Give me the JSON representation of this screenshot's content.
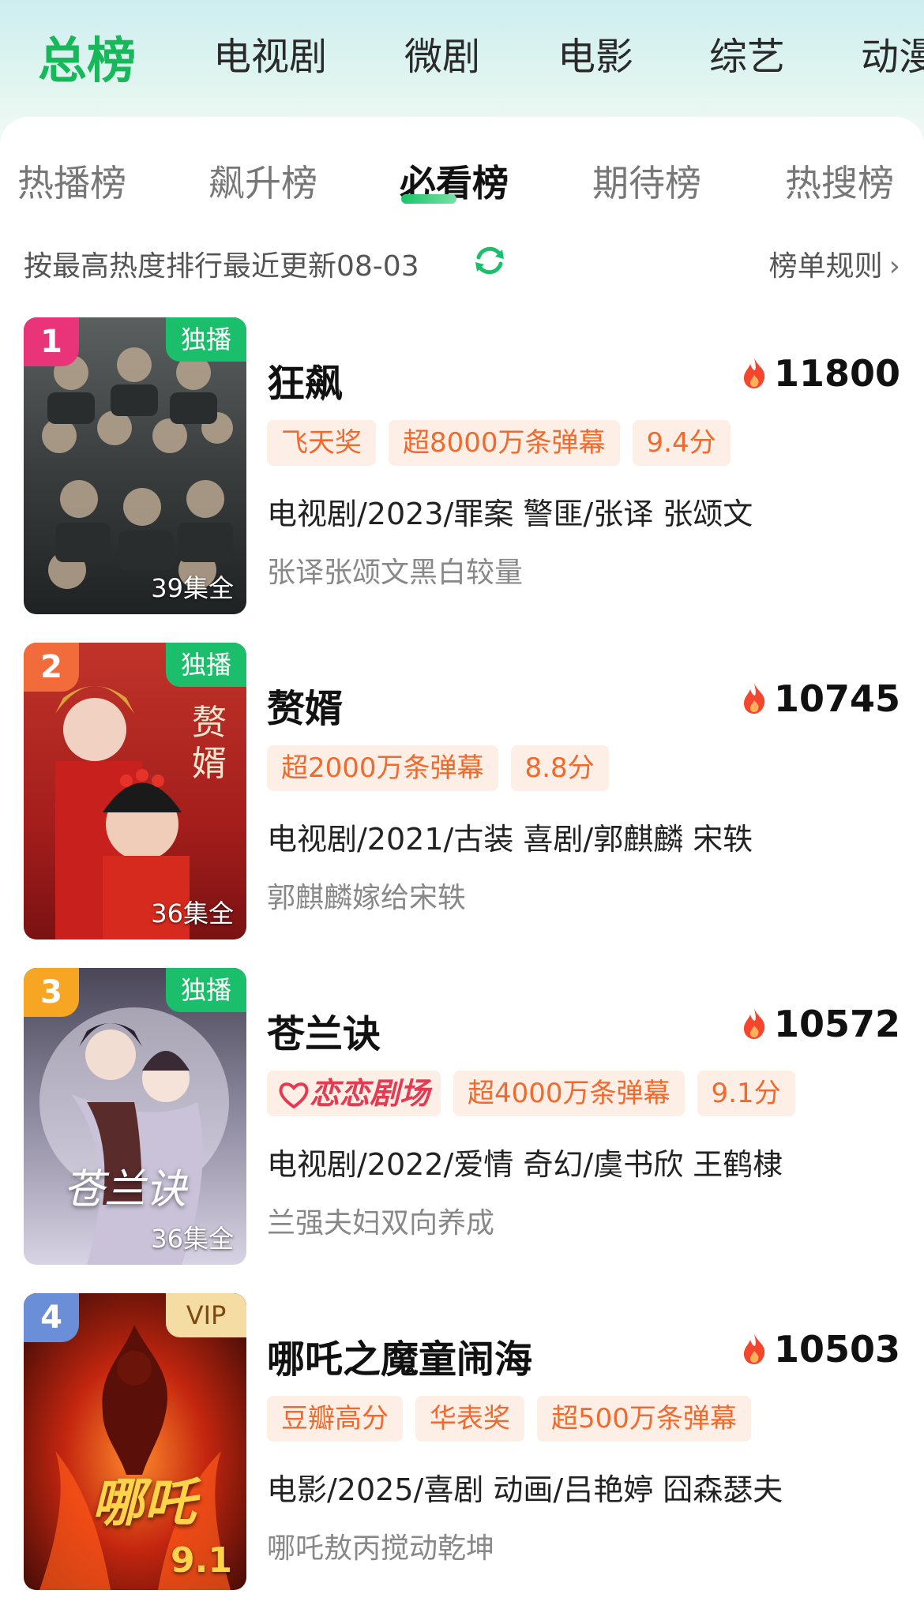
{
  "top_tabs": [
    "总榜",
    "电视剧",
    "微剧",
    "电影",
    "综艺",
    "动漫"
  ],
  "sub_tabs": [
    "热播榜",
    "飙升榜",
    "必看榜",
    "期待榜",
    "热搜榜"
  ],
  "info": {
    "sort_text": "按最高热度排行最近更新08-03",
    "rules_label": "榜单规则",
    "rules_arrow": "›"
  },
  "items": [
    {
      "rank": "1",
      "badge": "独播",
      "episodes": "39集全",
      "title": "狂飙",
      "heat": "11800",
      "tags": [
        "飞天奖",
        "超8000万条弹幕",
        "9.4分"
      ],
      "meta": "电视剧/2023/罪案 警匪/张译 张颂文",
      "desc": "张译张颂文黑白较量"
    },
    {
      "rank": "2",
      "badge": "独播",
      "episodes": "36集全",
      "poster_title": "赘婿",
      "title": "赘婿",
      "heat": "10745",
      "tags": [
        "超2000万条弹幕",
        "8.8分"
      ],
      "meta": "电视剧/2021/古装 喜剧/郭麒麟 宋轶",
      "desc": "郭麒麟嫁给宋轶"
    },
    {
      "rank": "3",
      "badge": "独播",
      "episodes": "36集全",
      "poster_title": "苍兰诀",
      "title": "苍兰诀",
      "heat": "10572",
      "logo_tag": "恋恋剧场",
      "tags": [
        "超4000万条弹幕",
        "9.1分"
      ],
      "meta": "电视剧/2022/爱情 奇幻/虞书欣 王鹤棣",
      "desc": "兰强夫妇双向养成"
    },
    {
      "rank": "4",
      "badge": "VIP",
      "poster_title": "哪吒",
      "poster_score": "9.1",
      "title": "哪吒之魔童闹海",
      "heat": "10503",
      "tags": [
        "豆瓣高分",
        "华表奖",
        "超500万条弹幕"
      ],
      "meta": "电影/2025/喜剧 动画/吕艳婷 囧森瑟夫",
      "desc": "哪吒敖丙搅动乾坤"
    }
  ],
  "colors": {
    "accent_green": "#17b85a",
    "tag_text": "#f06a2e",
    "tag_bg": "#fdeee6",
    "rank1": "#e9347a",
    "rank2": "#f26b3a",
    "rank3": "#f6a623",
    "rank4": "#6a8ed8"
  }
}
